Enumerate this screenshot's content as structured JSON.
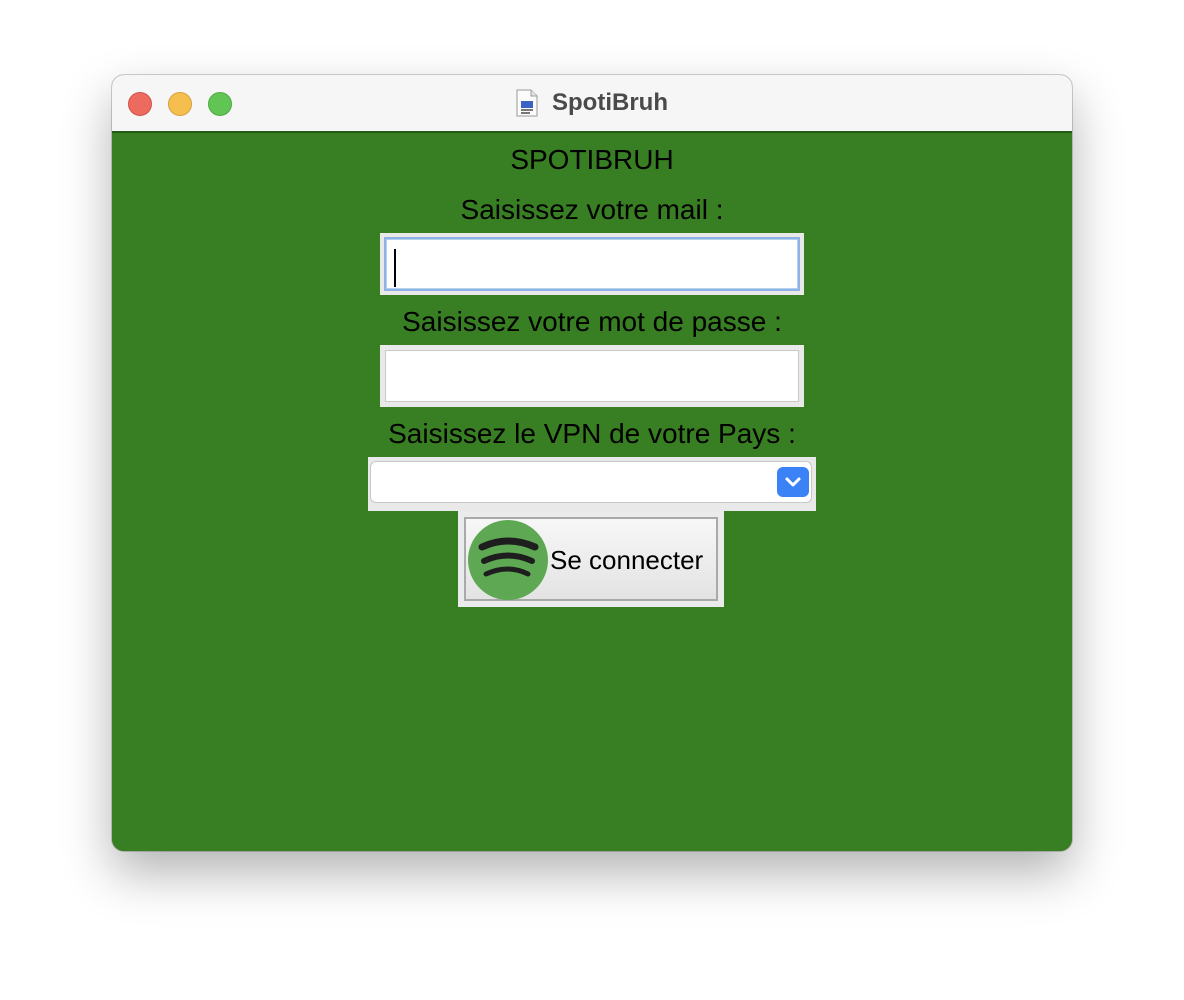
{
  "window": {
    "title": "SpotiBruh",
    "title_icon": "document-icon",
    "controls": [
      "close",
      "minimize",
      "zoom"
    ]
  },
  "app": {
    "heading": "SPOTIBRUH",
    "background_color": "#387e22"
  },
  "form": {
    "email_label": "Saisissez votre mail :",
    "email_value": "",
    "password_label": "Saisissez votre mot de passe :",
    "password_value": "",
    "vpn_label": "Saisissez le VPN de votre Pays :",
    "vpn_selected": "",
    "connect_button_label": "Se connecter",
    "connect_button_icon": "spotify-logo-icon"
  }
}
